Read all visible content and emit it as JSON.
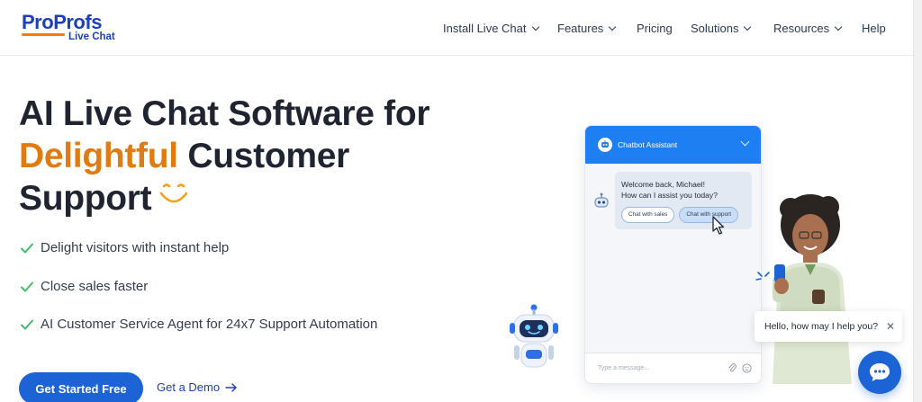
{
  "logo": {
    "brand_pro": "Pro",
    "brand_profs": "Profs",
    "product": "Live Chat"
  },
  "nav": {
    "items": [
      {
        "label": "Install Live Chat",
        "has_dropdown": true
      },
      {
        "label": "Features",
        "has_dropdown": true
      },
      {
        "label": "Pricing",
        "has_dropdown": false
      },
      {
        "label": "Solutions",
        "has_dropdown": true
      },
      {
        "label": "Resources",
        "has_dropdown": true
      },
      {
        "label": "Help",
        "has_dropdown": false
      }
    ]
  },
  "hero": {
    "line1": "AI Live Chat Software for",
    "accent": "Delightful",
    "line2_rest": "Customer",
    "line3": "Support",
    "features": [
      "Delight visitors with instant help",
      "Close sales faster",
      "AI Customer Service Agent for 24x7 Support Automation"
    ],
    "cta_primary": "Get Started Free",
    "cta_secondary": "Get a Demo"
  },
  "chat_widget": {
    "header_title": "Chatbot Assistant",
    "message_line1": "Welcome back, Michael!",
    "message_line2": "How can I assist you today?",
    "quick_replies": [
      "Chat with sales",
      "Chat with support"
    ],
    "input_placeholder": "Type a message..."
  },
  "popup": {
    "text": "Hello, how may I help you?"
  },
  "colors": {
    "brand_blue": "#1d3fb8",
    "accent_orange": "#e07b12",
    "cta_blue": "#1c63d6",
    "check_green": "#3fbf6a",
    "chat_header": "#1e7ff2"
  },
  "icons": [
    "chevron-down-icon",
    "check-icon",
    "smile-icon",
    "arrow-right-icon",
    "chat-bubble-icon",
    "close-icon",
    "paperclip-icon",
    "emoji-icon",
    "robot-icon"
  ]
}
